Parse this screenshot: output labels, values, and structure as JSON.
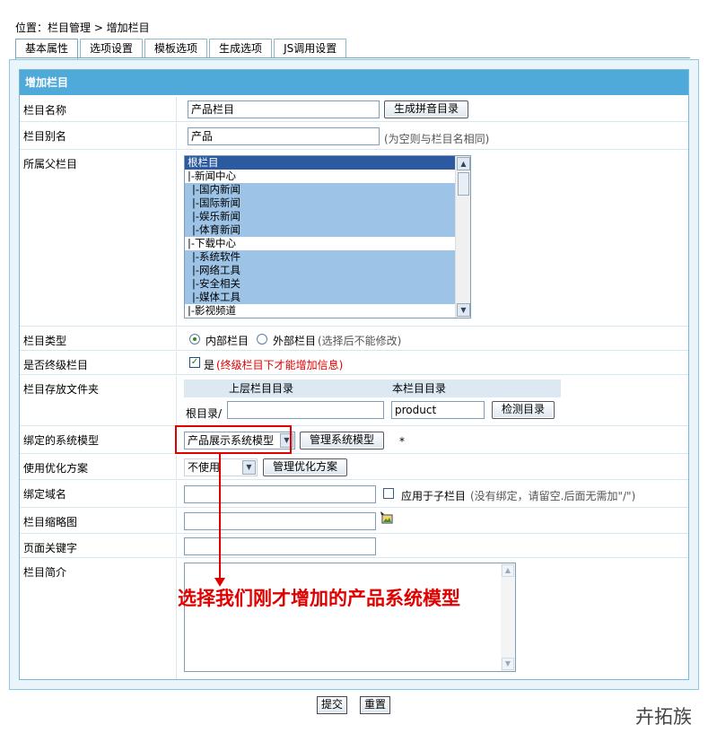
{
  "breadcrumb": "位置：栏目管理 > 增加栏目",
  "tabs": [
    "基本属性",
    "选项设置",
    "模板选项",
    "生成选项",
    "JS调用设置"
  ],
  "header": "增加栏目",
  "rows": {
    "name": {
      "label": "栏目名称",
      "value": "产品栏目",
      "button": "生成拼音目录"
    },
    "alias": {
      "label": "栏目别名",
      "value": "产品",
      "hint": "(为空则与栏目名相同)"
    },
    "parent": {
      "label": "所属父栏目",
      "options": [
        "根栏目",
        "|-新闻中心",
        " |-国内新闻",
        " |-国际新闻",
        " |-娱乐新闻",
        " |-体育新闻",
        "|-下载中心",
        " |-系统软件",
        " |-网络工具",
        " |-安全相关",
        " |-媒体工具",
        "|-影视频道"
      ]
    },
    "type": {
      "label": "栏目类型",
      "option_internal": "内部栏目",
      "option_external": "外部栏目",
      "hint": "(选择后不能修改)"
    },
    "final": {
      "label": "是否终级栏目",
      "check_label": "是",
      "hint": "(终级栏目下才能增加信息)"
    },
    "folder": {
      "label": "栏目存放文件夹",
      "col_parent": "上层栏目目录",
      "col_self": "本栏目目录",
      "prefix": "根目录/",
      "parent_value": "",
      "dir_value": "product",
      "button": "检测目录"
    },
    "model": {
      "label": "绑定的系统模型",
      "selected": "产品展示系统模型",
      "button": "管理系统模型",
      "required": "*"
    },
    "optimize": {
      "label": "使用优化方案",
      "selected": "不使用",
      "button": "管理优化方案"
    },
    "domain": {
      "label": "绑定域名",
      "value": "",
      "check_label": "应用于子栏目",
      "hint": "(没有绑定，请留空.后面无需加\"/\")"
    },
    "thumb": {
      "label": "栏目缩略图",
      "value": ""
    },
    "keywords": {
      "label": "页面关键字",
      "value": ""
    },
    "intro": {
      "label": "栏目简介",
      "value": ""
    }
  },
  "annotation": "选择我们刚才增加的产品系统模型",
  "buttons": {
    "submit": "提交",
    "reset": "重置"
  },
  "watermark": "卉拓族",
  "colors": {
    "header_bg": "#4fa9d9",
    "annotation": "#e00000",
    "list_selected": "#9dc3e6"
  }
}
